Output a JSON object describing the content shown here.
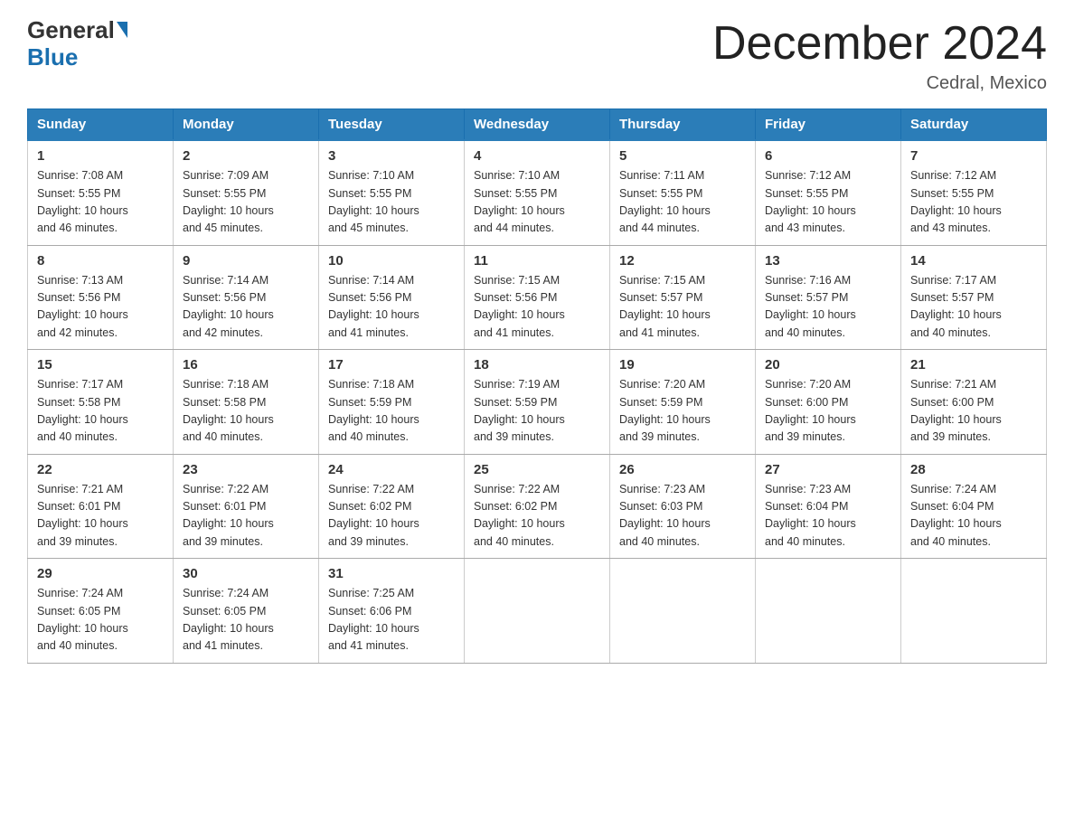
{
  "header": {
    "logo_general": "General",
    "logo_blue": "Blue",
    "month_title": "December 2024",
    "location": "Cedral, Mexico"
  },
  "days_of_week": [
    "Sunday",
    "Monday",
    "Tuesday",
    "Wednesday",
    "Thursday",
    "Friday",
    "Saturday"
  ],
  "weeks": [
    [
      {
        "day": "1",
        "sunrise": "7:08 AM",
        "sunset": "5:55 PM",
        "daylight": "10 hours and 46 minutes."
      },
      {
        "day": "2",
        "sunrise": "7:09 AM",
        "sunset": "5:55 PM",
        "daylight": "10 hours and 45 minutes."
      },
      {
        "day": "3",
        "sunrise": "7:10 AM",
        "sunset": "5:55 PM",
        "daylight": "10 hours and 45 minutes."
      },
      {
        "day": "4",
        "sunrise": "7:10 AM",
        "sunset": "5:55 PM",
        "daylight": "10 hours and 44 minutes."
      },
      {
        "day": "5",
        "sunrise": "7:11 AM",
        "sunset": "5:55 PM",
        "daylight": "10 hours and 44 minutes."
      },
      {
        "day": "6",
        "sunrise": "7:12 AM",
        "sunset": "5:55 PM",
        "daylight": "10 hours and 43 minutes."
      },
      {
        "day": "7",
        "sunrise": "7:12 AM",
        "sunset": "5:55 PM",
        "daylight": "10 hours and 43 minutes."
      }
    ],
    [
      {
        "day": "8",
        "sunrise": "7:13 AM",
        "sunset": "5:56 PM",
        "daylight": "10 hours and 42 minutes."
      },
      {
        "day": "9",
        "sunrise": "7:14 AM",
        "sunset": "5:56 PM",
        "daylight": "10 hours and 42 minutes."
      },
      {
        "day": "10",
        "sunrise": "7:14 AM",
        "sunset": "5:56 PM",
        "daylight": "10 hours and 41 minutes."
      },
      {
        "day": "11",
        "sunrise": "7:15 AM",
        "sunset": "5:56 PM",
        "daylight": "10 hours and 41 minutes."
      },
      {
        "day": "12",
        "sunrise": "7:15 AM",
        "sunset": "5:57 PM",
        "daylight": "10 hours and 41 minutes."
      },
      {
        "day": "13",
        "sunrise": "7:16 AM",
        "sunset": "5:57 PM",
        "daylight": "10 hours and 40 minutes."
      },
      {
        "day": "14",
        "sunrise": "7:17 AM",
        "sunset": "5:57 PM",
        "daylight": "10 hours and 40 minutes."
      }
    ],
    [
      {
        "day": "15",
        "sunrise": "7:17 AM",
        "sunset": "5:58 PM",
        "daylight": "10 hours and 40 minutes."
      },
      {
        "day": "16",
        "sunrise": "7:18 AM",
        "sunset": "5:58 PM",
        "daylight": "10 hours and 40 minutes."
      },
      {
        "day": "17",
        "sunrise": "7:18 AM",
        "sunset": "5:59 PM",
        "daylight": "10 hours and 40 minutes."
      },
      {
        "day": "18",
        "sunrise": "7:19 AM",
        "sunset": "5:59 PM",
        "daylight": "10 hours and 39 minutes."
      },
      {
        "day": "19",
        "sunrise": "7:20 AM",
        "sunset": "5:59 PM",
        "daylight": "10 hours and 39 minutes."
      },
      {
        "day": "20",
        "sunrise": "7:20 AM",
        "sunset": "6:00 PM",
        "daylight": "10 hours and 39 minutes."
      },
      {
        "day": "21",
        "sunrise": "7:21 AM",
        "sunset": "6:00 PM",
        "daylight": "10 hours and 39 minutes."
      }
    ],
    [
      {
        "day": "22",
        "sunrise": "7:21 AM",
        "sunset": "6:01 PM",
        "daylight": "10 hours and 39 minutes."
      },
      {
        "day": "23",
        "sunrise": "7:22 AM",
        "sunset": "6:01 PM",
        "daylight": "10 hours and 39 minutes."
      },
      {
        "day": "24",
        "sunrise": "7:22 AM",
        "sunset": "6:02 PM",
        "daylight": "10 hours and 39 minutes."
      },
      {
        "day": "25",
        "sunrise": "7:22 AM",
        "sunset": "6:02 PM",
        "daylight": "10 hours and 40 minutes."
      },
      {
        "day": "26",
        "sunrise": "7:23 AM",
        "sunset": "6:03 PM",
        "daylight": "10 hours and 40 minutes."
      },
      {
        "day": "27",
        "sunrise": "7:23 AM",
        "sunset": "6:04 PM",
        "daylight": "10 hours and 40 minutes."
      },
      {
        "day": "28",
        "sunrise": "7:24 AM",
        "sunset": "6:04 PM",
        "daylight": "10 hours and 40 minutes."
      }
    ],
    [
      {
        "day": "29",
        "sunrise": "7:24 AM",
        "sunset": "6:05 PM",
        "daylight": "10 hours and 40 minutes."
      },
      {
        "day": "30",
        "sunrise": "7:24 AM",
        "sunset": "6:05 PM",
        "daylight": "10 hours and 41 minutes."
      },
      {
        "day": "31",
        "sunrise": "7:25 AM",
        "sunset": "6:06 PM",
        "daylight": "10 hours and 41 minutes."
      },
      null,
      null,
      null,
      null
    ]
  ],
  "labels": {
    "sunrise": "Sunrise:",
    "sunset": "Sunset:",
    "daylight": "Daylight:"
  }
}
